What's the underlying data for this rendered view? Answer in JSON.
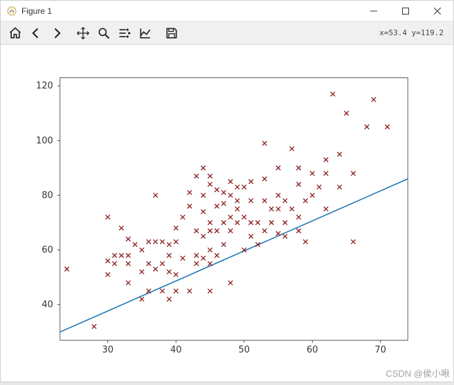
{
  "window": {
    "title": "Figure 1"
  },
  "toolbar": {
    "coord_readout": "x=53.4 y=119.2"
  },
  "watermark": "CSDN @侯小啾",
  "chart_data": {
    "type": "scatter",
    "xlabel": "",
    "ylabel": "",
    "title": "",
    "xlim": [
      23,
      74
    ],
    "ylim": [
      27,
      123
    ],
    "xticks": [
      30,
      40,
      50,
      60,
      70
    ],
    "yticks": [
      40,
      60,
      80,
      100,
      120
    ],
    "line": {
      "x1": 23,
      "y1": 30,
      "x2": 74,
      "y2": 86
    },
    "points": [
      [
        24,
        53
      ],
      [
        28,
        32
      ],
      [
        30,
        51
      ],
      [
        30,
        56
      ],
      [
        30,
        72
      ],
      [
        31,
        55
      ],
      [
        31,
        58
      ],
      [
        32,
        58
      ],
      [
        32,
        68
      ],
      [
        33,
        48
      ],
      [
        33,
        55
      ],
      [
        33,
        58
      ],
      [
        33,
        64
      ],
      [
        34,
        62
      ],
      [
        35,
        42
      ],
      [
        35,
        52
      ],
      [
        35,
        60
      ],
      [
        36,
        45
      ],
      [
        36,
        55
      ],
      [
        36,
        63
      ],
      [
        37,
        53
      ],
      [
        37,
        63
      ],
      [
        37,
        80
      ],
      [
        38,
        45
      ],
      [
        38,
        55
      ],
      [
        38,
        63
      ],
      [
        39,
        42
      ],
      [
        39,
        52
      ],
      [
        39,
        58
      ],
      [
        39,
        62
      ],
      [
        40,
        45
      ],
      [
        40,
        51
      ],
      [
        40,
        63
      ],
      [
        40,
        68
      ],
      [
        41,
        57
      ],
      [
        41,
        72
      ],
      [
        42,
        45
      ],
      [
        42,
        76
      ],
      [
        42,
        81
      ],
      [
        43,
        55
      ],
      [
        43,
        58
      ],
      [
        43,
        67
      ],
      [
        43,
        87
      ],
      [
        44,
        57
      ],
      [
        44,
        65
      ],
      [
        44,
        74
      ],
      [
        44,
        80
      ],
      [
        44,
        90
      ],
      [
        45,
        45
      ],
      [
        45,
        55
      ],
      [
        45,
        60
      ],
      [
        45,
        67
      ],
      [
        45,
        70
      ],
      [
        45,
        84
      ],
      [
        45,
        87
      ],
      [
        46,
        58
      ],
      [
        46,
        67
      ],
      [
        46,
        76
      ],
      [
        46,
        82
      ],
      [
        47,
        62
      ],
      [
        47,
        70
      ],
      [
        47,
        77
      ],
      [
        47,
        81
      ],
      [
        48,
        48
      ],
      [
        48,
        67
      ],
      [
        48,
        72
      ],
      [
        48,
        80
      ],
      [
        48,
        85
      ],
      [
        49,
        70
      ],
      [
        49,
        75
      ],
      [
        49,
        78
      ],
      [
        49,
        83
      ],
      [
        50,
        60
      ],
      [
        50,
        72
      ],
      [
        50,
        83
      ],
      [
        51,
        65
      ],
      [
        51,
        70
      ],
      [
        51,
        78
      ],
      [
        51,
        85
      ],
      [
        52,
        62
      ],
      [
        52,
        70
      ],
      [
        53,
        67
      ],
      [
        53,
        78
      ],
      [
        53,
        86
      ],
      [
        53,
        99
      ],
      [
        54,
        70
      ],
      [
        54,
        75
      ],
      [
        55,
        66
      ],
      [
        55,
        75
      ],
      [
        55,
        80
      ],
      [
        55,
        90
      ],
      [
        56,
        65
      ],
      [
        56,
        70
      ],
      [
        56,
        78
      ],
      [
        57,
        75
      ],
      [
        57,
        97
      ],
      [
        58,
        67
      ],
      [
        58,
        72
      ],
      [
        58,
        84
      ],
      [
        58,
        90
      ],
      [
        59,
        63
      ],
      [
        59,
        78
      ],
      [
        60,
        80
      ],
      [
        60,
        88
      ],
      [
        61,
        83
      ],
      [
        62,
        75
      ],
      [
        62,
        88
      ],
      [
        62,
        93
      ],
      [
        63,
        117
      ],
      [
        64,
        83
      ],
      [
        64,
        95
      ],
      [
        65,
        110
      ],
      [
        66,
        63
      ],
      [
        66,
        88
      ],
      [
        68,
        105
      ],
      [
        69,
        115
      ],
      [
        71,
        105
      ]
    ]
  }
}
